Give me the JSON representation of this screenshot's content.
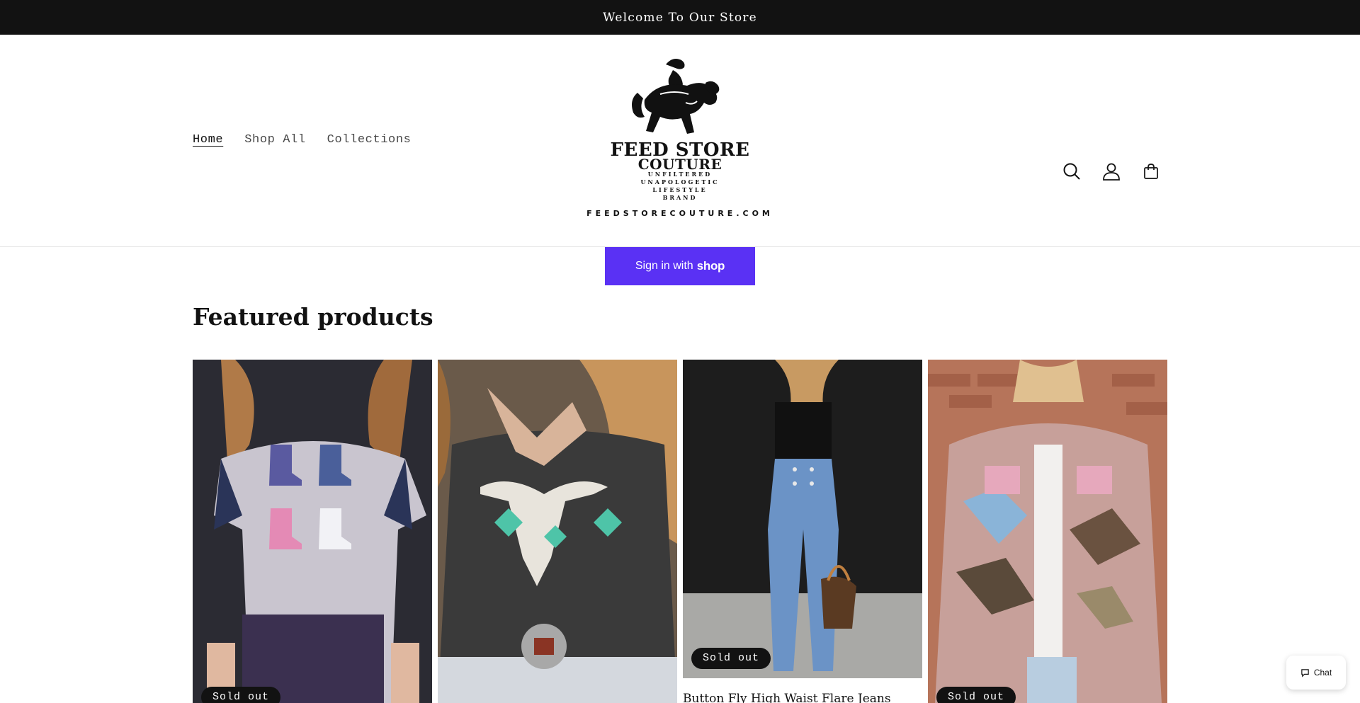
{
  "announcement": {
    "text": "Welcome To Our Store"
  },
  "nav": {
    "items": [
      {
        "label": "Home"
      },
      {
        "label": "Shop All"
      },
      {
        "label": "Collections"
      }
    ]
  },
  "logo": {
    "line1": "FEED STORE",
    "line2": "COUTURE",
    "tagline1": "UNFILTERED",
    "tagline2": "UNAPOLOGETIC",
    "tagline3": "LIFESTYLE",
    "tagline4": "BRAND",
    "domain": "FEEDSTORECOUTURE.COM"
  },
  "header_icons": [
    "search-icon",
    "account-icon",
    "cart-icon"
  ],
  "shop_signin": {
    "prefix": "Sign in with",
    "brand": "shop",
    "color": "#5a31f4"
  },
  "featured": {
    "title": "Featured products",
    "products": [
      {
        "badge": "Sold out",
        "title": ""
      },
      {
        "badge": "",
        "title": ""
      },
      {
        "badge": "Sold out",
        "title": "Button Fly High Waist Flare Jeans"
      },
      {
        "badge": "Sold out",
        "title": ""
      }
    ]
  },
  "chat": {
    "label": "Chat"
  },
  "colors": {
    "announcement_bg": "#121212",
    "shop_purple": "#5a31f4",
    "text": "#121212"
  }
}
